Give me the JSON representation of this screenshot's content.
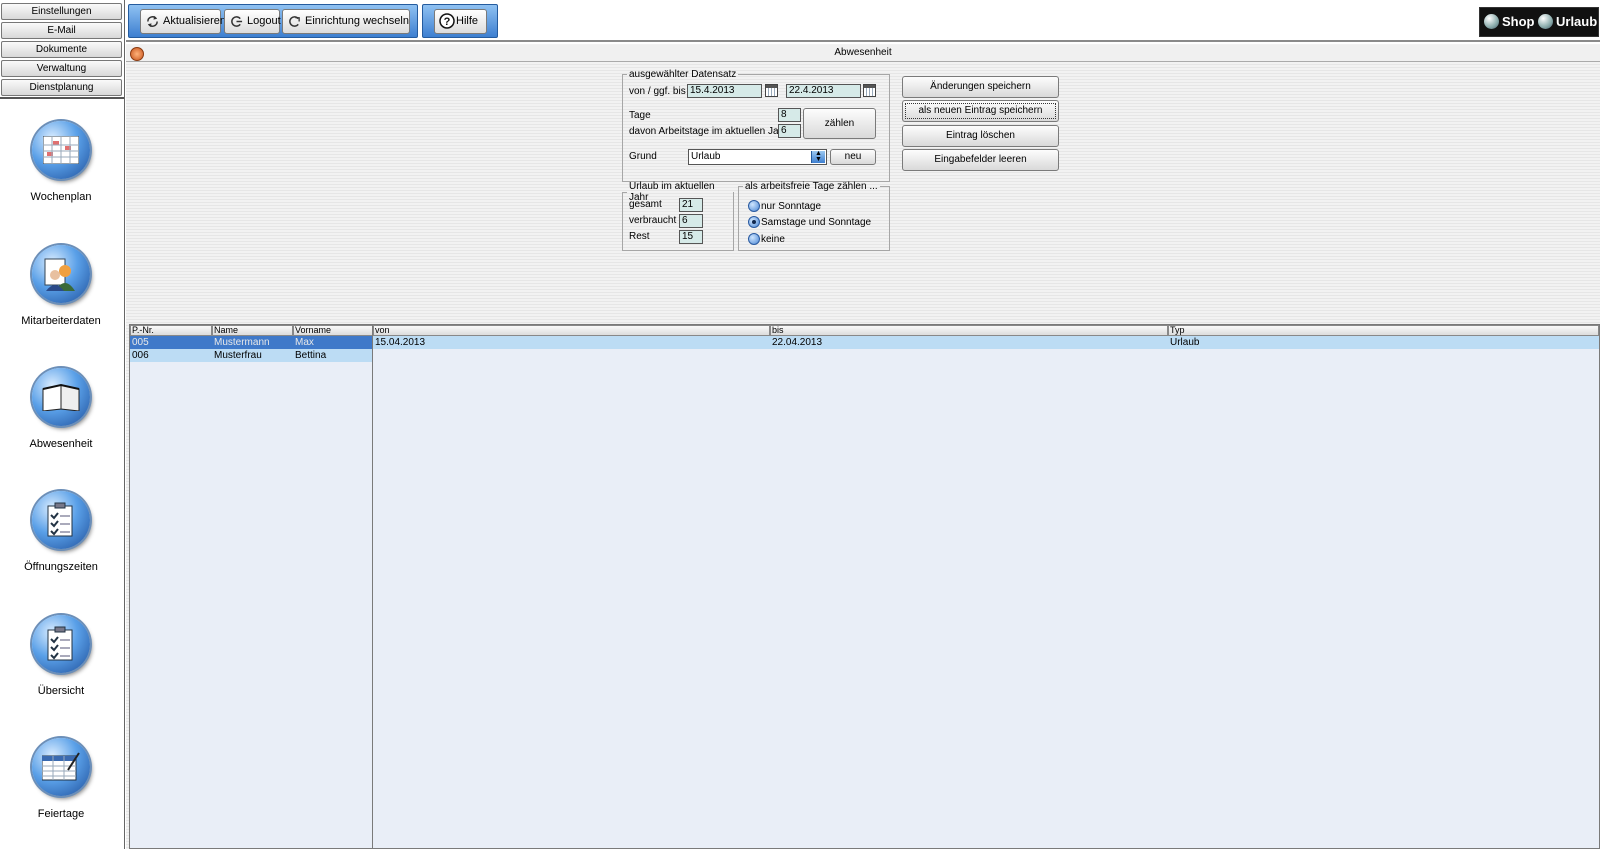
{
  "sidebar": {
    "nav_buttons": [
      "Einstellungen",
      "E-Mail",
      "Dokumente",
      "Verwaltung",
      "Dienstplanung"
    ],
    "modules": [
      {
        "label": "Wochenplan",
        "icon": "calendar-grid-icon"
      },
      {
        "label": "Mitarbeiterdaten",
        "icon": "employees-icon"
      },
      {
        "label": "Abwesenheit",
        "icon": "open-book-icon"
      },
      {
        "label": "Öffnungszeiten",
        "icon": "checklist-clipboard-icon"
      },
      {
        "label": "Übersicht",
        "icon": "checklist-clipboard-icon"
      },
      {
        "label": "Feiertage",
        "icon": "table-pen-icon"
      }
    ]
  },
  "toolbar": {
    "refresh_label": "Aktualisieren",
    "logout_label": "Logout",
    "switch_label": "Einrichtung wechseln",
    "help_label": "Hilfe",
    "shop_label": "Shop",
    "vacation_label": "Urlaub"
  },
  "page": {
    "title": "Abwesenheit"
  },
  "record": {
    "legend": "ausgewählter Datensatz",
    "range_label": "von / ggf. bis",
    "from_value": "15.4.2013",
    "to_value": "22.4.2013",
    "days_label": "Tage",
    "days_value": "8",
    "workdays_label": "davon Arbeitstage im aktuellen Jahr",
    "workdays_value": "6",
    "count_button": "zählen",
    "reason_label": "Grund",
    "reason_value": "Urlaub",
    "new_button": "neu"
  },
  "actions": {
    "save_changes": "Änderungen speichern",
    "save_new": "als neuen Eintrag speichern",
    "delete_entry": "Eintrag löschen",
    "clear_fields": "Eingabefelder leeren"
  },
  "vacation": {
    "legend": "Urlaub im aktuellen Jahr",
    "total_label": "gesamt",
    "total_value": "21",
    "used_label": "verbraucht",
    "used_value": "6",
    "rest_label": "Rest",
    "rest_value": "15"
  },
  "free_days": {
    "legend": "als arbeitsfreie Tage zählen ...",
    "options": [
      "nur Sonntage",
      "Samstage und Sonntage",
      "keine"
    ],
    "selected": "Samstage und Sonntage"
  },
  "employees": {
    "headers": [
      "P.-Nr.",
      "Name",
      "Vorname"
    ],
    "rows": [
      [
        "005",
        "Mustermann",
        "Max"
      ],
      [
        "006",
        "Musterfrau",
        "Bettina"
      ]
    ]
  },
  "absences": {
    "headers": [
      "von",
      "bis",
      "Typ"
    ],
    "rows": [
      [
        "15.04.2013",
        "22.04.2013",
        "Urlaub"
      ]
    ]
  },
  "colors": {
    "selection": "#3f79c9",
    "light_selection": "#bcdcf4",
    "toolbar_blue": "#3d7fd0",
    "field_bg": "#d6eae8"
  }
}
